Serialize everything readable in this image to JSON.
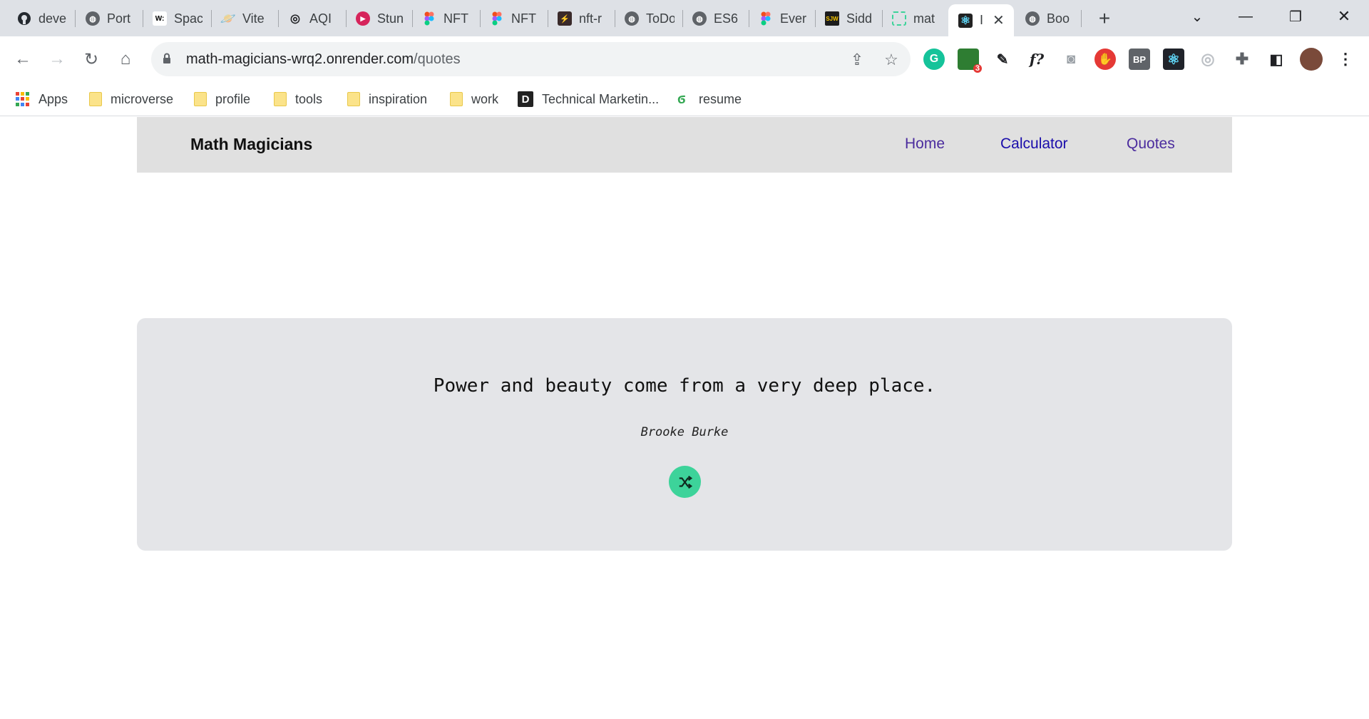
{
  "browser": {
    "tabs": [
      {
        "label": "deve",
        "icon": "github-icon"
      },
      {
        "label": "Port",
        "icon": "globe-icon"
      },
      {
        "label": "Spac",
        "icon": "w-icon"
      },
      {
        "label": "Vite",
        "icon": "planet-icon"
      },
      {
        "label": "AQI",
        "icon": "aqi-icon"
      },
      {
        "label": "Stun",
        "icon": "play-icon"
      },
      {
        "label": "NFT",
        "icon": "figma-icon"
      },
      {
        "label": "NFT",
        "icon": "figma-icon"
      },
      {
        "label": "nft-r",
        "icon": "bolt-icon"
      },
      {
        "label": "ToDo",
        "icon": "globe-icon"
      },
      {
        "label": "ES6",
        "icon": "globe-icon"
      },
      {
        "label": "Ever",
        "icon": "figma-icon"
      },
      {
        "label": "Sidd",
        "icon": "portfolio-icon"
      },
      {
        "label": "mat",
        "icon": "render-icon"
      },
      {
        "label": "I",
        "icon": "react-icon",
        "active": true
      },
      {
        "label": "Boo",
        "icon": "globe-icon"
      }
    ],
    "address": {
      "host": "math-magicians-wrq2.onrender.com",
      "path": "/quotes"
    },
    "extension_badge": "3",
    "bookmarks": [
      {
        "label": "Apps",
        "type": "apps"
      },
      {
        "label": "microverse",
        "type": "folder"
      },
      {
        "label": "profile",
        "type": "folder"
      },
      {
        "label": "tools",
        "type": "folder"
      },
      {
        "label": "inspiration",
        "type": "folder"
      },
      {
        "label": "work",
        "type": "folder"
      },
      {
        "label": "Technical Marketin...",
        "type": "dev-icon"
      },
      {
        "label": "resume",
        "type": "resume-icon"
      }
    ]
  },
  "site": {
    "brand": "Math Magicians",
    "nav": {
      "home": "Home",
      "calculator": "Calculator",
      "quotes": "Quotes"
    },
    "quote": {
      "text": "Power and beauty come from a very deep place.",
      "author": "Brooke Burke"
    }
  },
  "colors": {
    "accent": "#3dd39a",
    "nav_bg": "#e0e0e0",
    "card_bg": "#e4e5e8"
  }
}
